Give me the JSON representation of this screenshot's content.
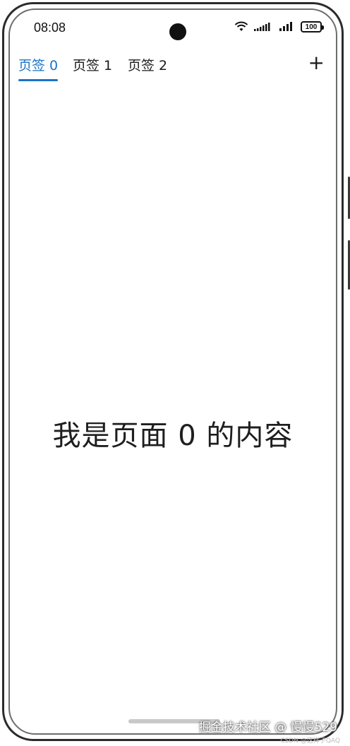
{
  "status_bar": {
    "time": "08:08",
    "battery": "100"
  },
  "tabs": [
    {
      "label": "页签 0",
      "active": true
    },
    {
      "label": "页签 1",
      "active": false
    },
    {
      "label": "页签 2",
      "active": false
    }
  ],
  "add_tab_label": "+",
  "content": {
    "text": "我是页面 0 的内容"
  },
  "watermark": {
    "main": "掘金技术社区 @ 慢慢529",
    "small": "CSDN @这样子QAQ"
  },
  "colors": {
    "accent": "#1a73c9",
    "text": "#1e1e1e",
    "frame": "#2b2b2b"
  }
}
